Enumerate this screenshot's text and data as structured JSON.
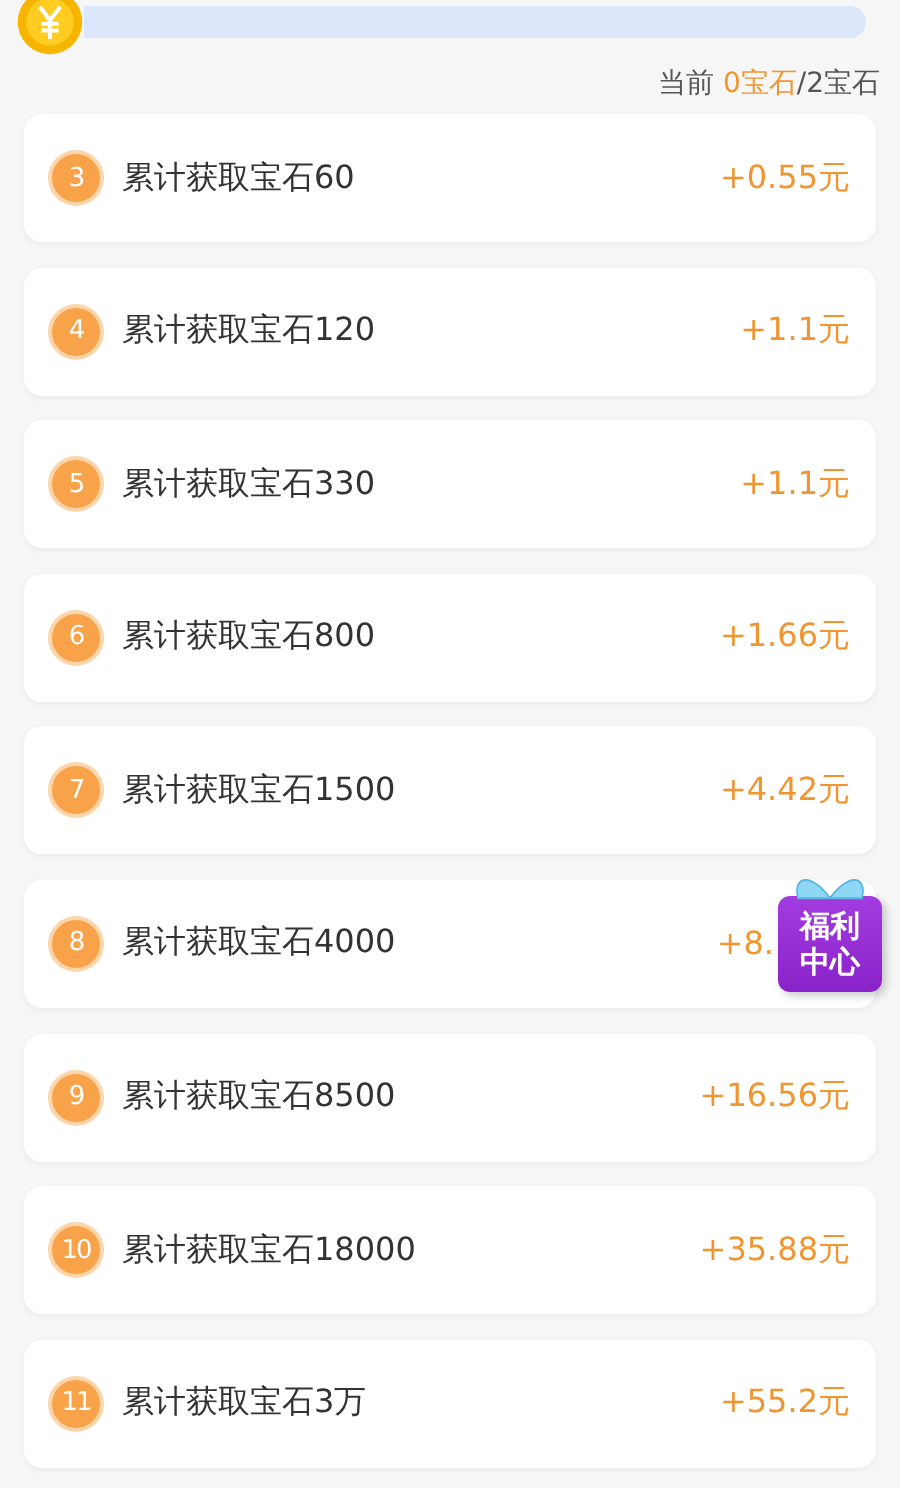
{
  "progress": {
    "level": 0,
    "label": "当前",
    "current": "0宝石",
    "target": "/2宝石"
  },
  "tasks": [
    {
      "index": "3",
      "title": "累计获取宝石60",
      "reward": "+0.55元",
      "kind": "plain"
    },
    {
      "index": "4",
      "title": "累计获取宝石120",
      "reward": "+1.1元",
      "kind": "plain"
    },
    {
      "index": "5",
      "title": "累计获取宝石330",
      "reward": "+1.1元",
      "kind": "plain"
    },
    {
      "index": "6",
      "title": "累计获取宝石800",
      "reward": "+1.66元",
      "kind": "plain"
    },
    {
      "index": "7",
      "title": "累计获取宝石1500",
      "reward": "+4.42元",
      "kind": "plain"
    },
    {
      "index": "8",
      "title": "累计获取宝石4000",
      "reward": "+8.",
      "kind": "covered"
    },
    {
      "index": "9",
      "title": "累计获取宝石8500",
      "reward": "+16.56元",
      "kind": "plain"
    },
    {
      "index": "10",
      "title": "累计获取宝石18000",
      "reward": "+35.88元",
      "kind": "plain"
    },
    {
      "index": "11",
      "title": "累计获取宝石3万",
      "reward": "+55.2元",
      "kind": "plain"
    }
  ],
  "floating_badge": {
    "line1": "福利",
    "line2": "中心"
  }
}
